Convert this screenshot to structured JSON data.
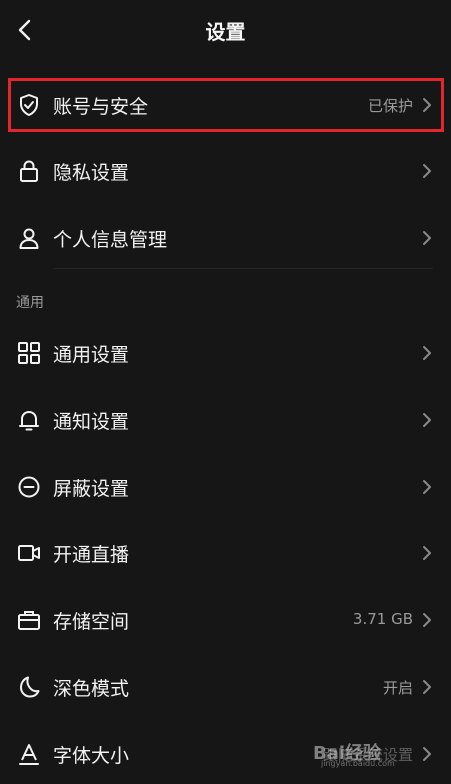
{
  "header": {
    "title": "设置"
  },
  "rows": [
    {
      "label": "账号与安全",
      "value": "已保护",
      "icon": "shield-check-icon"
    },
    {
      "label": "隐私设置",
      "value": "",
      "icon": "lock-icon"
    },
    {
      "label": "个人信息管理",
      "value": "",
      "icon": "person-icon"
    },
    {
      "label": "通用设置",
      "value": "",
      "icon": "grid-icon"
    },
    {
      "label": "通知设置",
      "value": "",
      "icon": "bell-icon"
    },
    {
      "label": "屏蔽设置",
      "value": "",
      "icon": "block-icon"
    },
    {
      "label": "开通直播",
      "value": "",
      "icon": "video-camera-icon"
    },
    {
      "label": "存储空间",
      "value": "3.71 GB",
      "icon": "storage-box-icon"
    },
    {
      "label": "深色模式",
      "value": "开启",
      "icon": "moon-icon"
    },
    {
      "label": "字体大小",
      "value": "跟随系统设置",
      "icon": "font-size-icon"
    }
  ],
  "sections": {
    "general": "通用"
  },
  "watermark": {
    "main": "Bai经验",
    "sub": "jingyan.baidu.com"
  },
  "colors": {
    "background": "#161616",
    "highlight": "#e3252c",
    "secondary_text": "#9a9a9a"
  }
}
